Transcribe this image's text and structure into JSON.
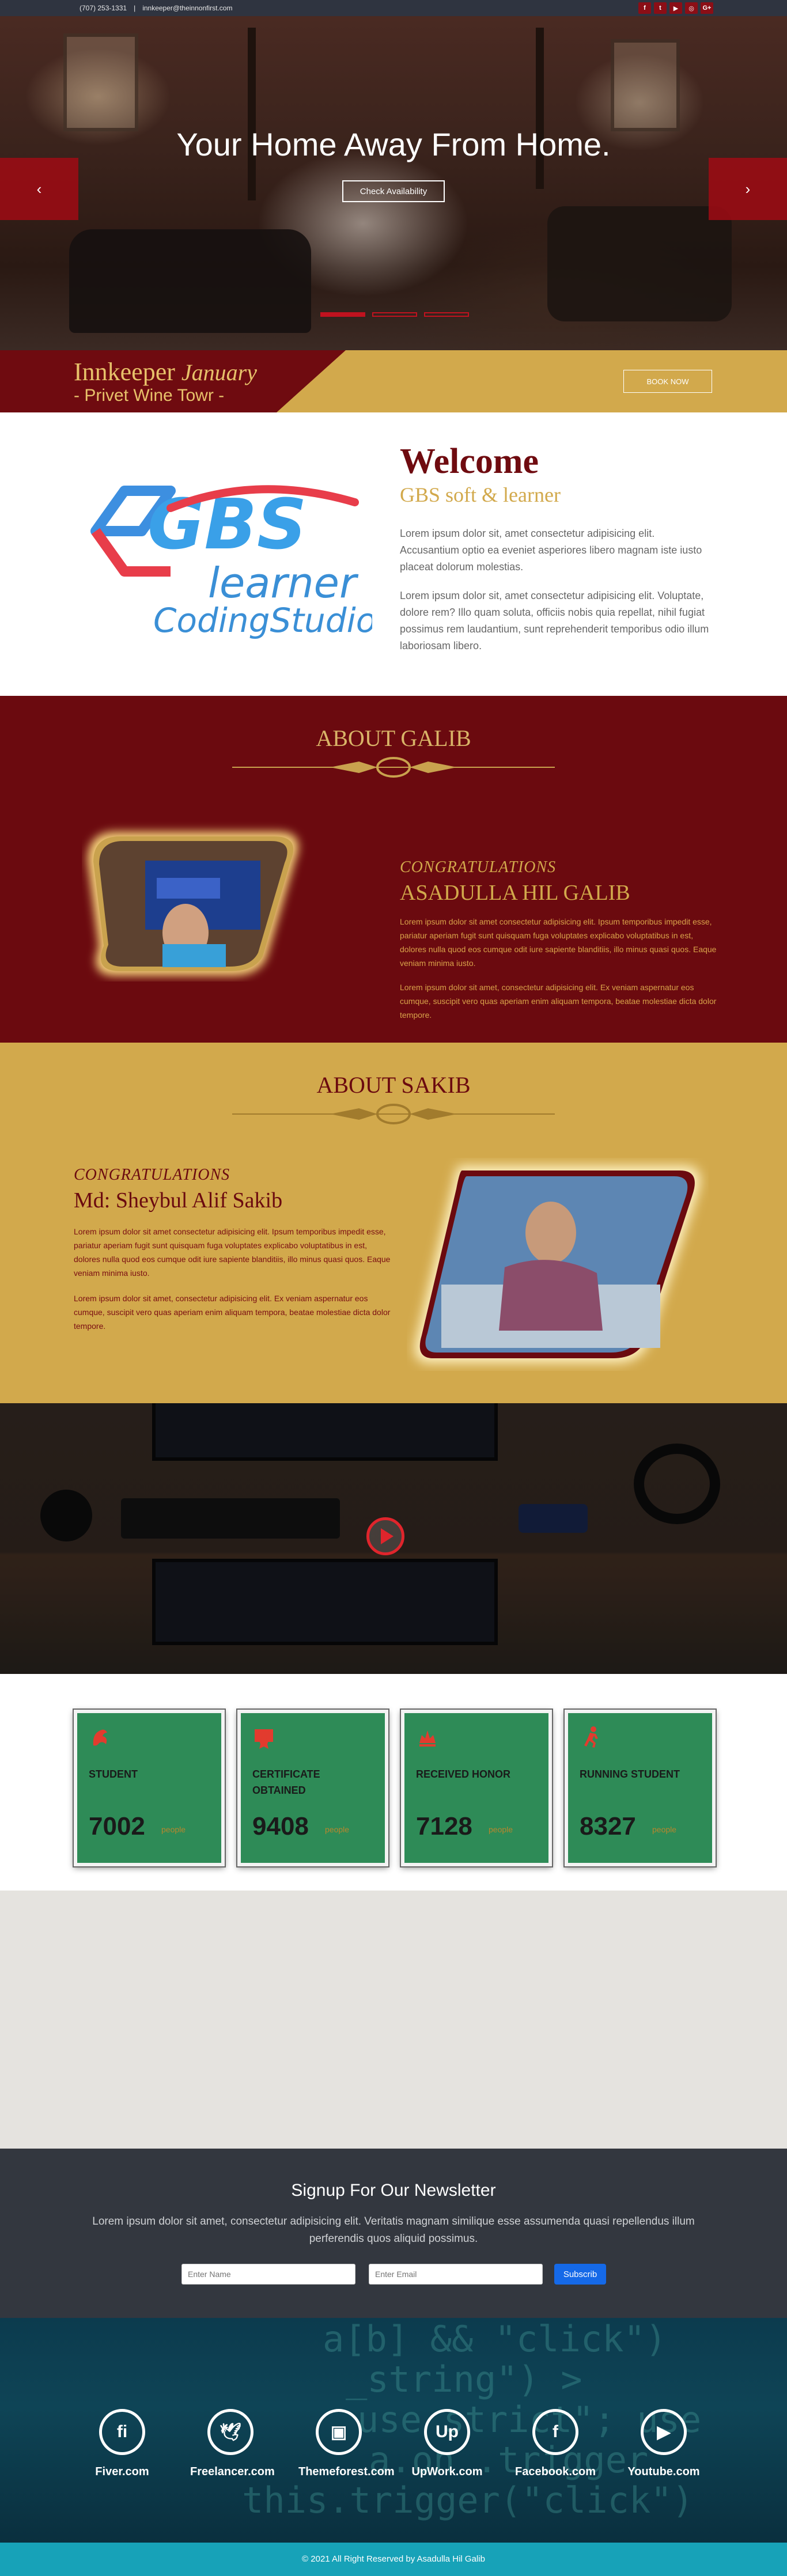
{
  "topbar": {
    "phone": "(707) 253-1331",
    "separator": "|",
    "email": "innkeeper@theinnonfirst.com",
    "social_icons": [
      {
        "icon": "facebook-icon",
        "glyph": "f"
      },
      {
        "icon": "twitter-icon",
        "glyph": "t"
      },
      {
        "icon": "youtube-icon",
        "glyph": "▶"
      },
      {
        "icon": "instagram-icon",
        "glyph": "◎"
      },
      {
        "icon": "google-plus-icon",
        "glyph": "G+"
      }
    ]
  },
  "hero": {
    "heading": "Your Home Away From Home.",
    "button": "Check Availability",
    "prev_glyph": "‹",
    "next_glyph": "›",
    "slides": 3,
    "active_slide": 1
  },
  "booking": {
    "name": "Innkeeper",
    "month": "January",
    "subtitle": "- Privet Wine Towr -",
    "button": "BOOK NOW"
  },
  "welcome": {
    "title": "Welcome",
    "subtitle": "GBS soft & learner",
    "logo_text": {
      "brand": "GBS",
      "learner": "learner",
      "studio": "CodingStudio"
    },
    "paragraphs": [
      "Lorem ipsum dolor sit, amet consectetur adipisicing elit. Accusantium optio ea eveniet asperiores libero magnam iste iusto placeat dolorum molestias.",
      "Lorem ipsum dolor sit, amet consectetur adipisicing elit. Voluptate, dolore rem? Illo quam soluta, officiis nobis quia repellat, nihil fugiat possimus rem laudantium, sunt reprehenderit temporibus odio illum laboriosam libero."
    ]
  },
  "about_galib": {
    "heading": "ABOUT GALIB",
    "congrats": "CONGRATULATIONS",
    "name": "ASADULLA HIL GALIB",
    "paragraphs": [
      "Lorem ipsum dolor sit amet consectetur adipisicing elit. Ipsum temporibus impedit esse, pariatur aperiam fugit sunt quisquam fuga voluptates explicabo voluptatibus in est, dolores nulla quod eos cumque odit iure sapiente blanditiis, illo minus quasi quos. Eaque veniam minima iusto.",
      "Lorem ipsum dolor sit amet, consectetur adipisicing elit. Ex veniam aspernatur eos cumque, suscipit vero quas aperiam enim aliquam tempora, beatae molestiae dicta dolor tempore."
    ]
  },
  "about_sakib": {
    "heading": "ABOUT SAKIB",
    "congrats": "CONGRATULATIONS",
    "name": "Md: Sheybul Alif Sakib",
    "paragraphs": [
      "Lorem ipsum dolor sit amet consectetur adipisicing elit. Ipsum temporibus impedit esse, pariatur aperiam fugit sunt quisquam fuga voluptates explicabo voluptatibus in est, dolores nulla quod eos cumque odit iure sapiente blanditiis, illo minus quasi quos. Eaque veniam minima iusto.",
      "Lorem ipsum dolor sit amet, consectetur adipisicing elit. Ex veniam aspernatur eos cumque, suscipit vero quas aperiam enim aliquam tempora, beatae molestiae dicta dolor tempore."
    ]
  },
  "stats": [
    {
      "icon": "dragon-icon",
      "label": "STUDENT",
      "value": "7002",
      "unit": "people"
    },
    {
      "icon": "certificate-icon",
      "label": "CERTIFICATE OBTAINED",
      "value": "9408",
      "unit": "people"
    },
    {
      "icon": "honor-icon",
      "label": "RECEIVED HONOR",
      "value": "7128",
      "unit": "people"
    },
    {
      "icon": "running-icon",
      "label": "RUNNING STUDENT",
      "value": "8327",
      "unit": "people"
    }
  ],
  "newsletter": {
    "title": "Signup For Our Newsletter",
    "text": "Lorem ipsum dolor sit amet, consectetur adipisicing elit. Veritatis magnam similique esse assumenda quasi repellendus illum perferendis quos aliquid possimus.",
    "name_placeholder": "Enter Name",
    "email_placeholder": "Enter Email",
    "button": "Subscrib"
  },
  "social_links": [
    {
      "icon": "fiverr-icon",
      "glyph": "fi",
      "label": "Fiver.com"
    },
    {
      "icon": "freelancer-icon",
      "glyph": "🕊",
      "label": "Freelancer.com"
    },
    {
      "icon": "themeforest-icon",
      "glyph": "▣",
      "label": "Themeforest.com"
    },
    {
      "icon": "upwork-icon",
      "glyph": "Up",
      "label": "UpWork.com"
    },
    {
      "icon": "facebook-icon",
      "glyph": "f",
      "label": "Facebook.com"
    },
    {
      "icon": "youtube-icon",
      "glyph": "▶",
      "label": "Youtube.com"
    }
  ],
  "copyright": "© 2021 All Right Reserved by Asadulla Hil Galib",
  "colors": {
    "maroon": "#6b0a0f",
    "gold": "#d2a94c",
    "green": "#2e8b57",
    "dark": "#33373f",
    "teal": "#17a2b8",
    "accent_red": "#c0121f"
  }
}
